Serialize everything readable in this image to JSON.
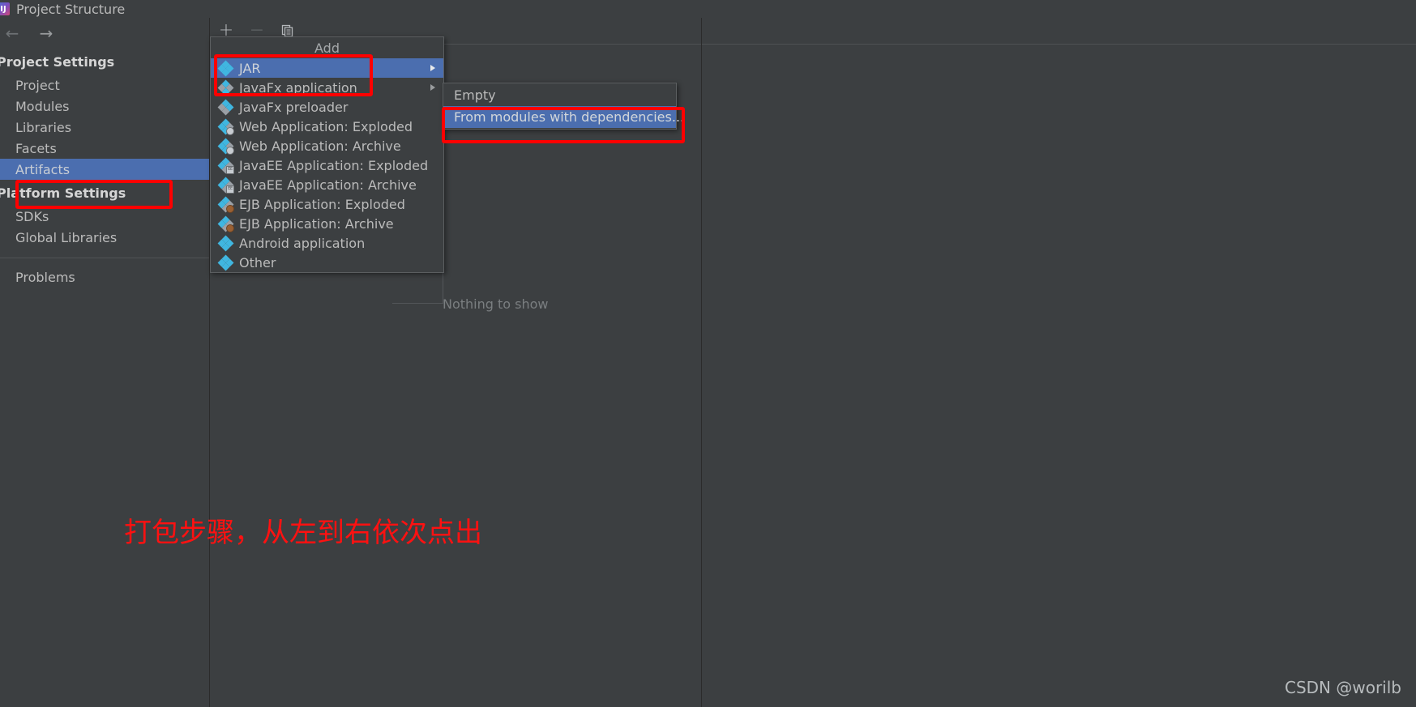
{
  "window": {
    "title": "Project Structure",
    "app_icon": "intellij-idea-icon"
  },
  "nav": {
    "back_label": "←",
    "forward_label": "→"
  },
  "sidebar": {
    "project_settings_title": "Project Settings",
    "project_items": [
      {
        "label": "Project"
      },
      {
        "label": "Modules"
      },
      {
        "label": "Libraries"
      },
      {
        "label": "Facets"
      },
      {
        "label": "Artifacts"
      }
    ],
    "platform_settings_title": "Platform Settings",
    "platform_items": [
      {
        "label": "SDKs"
      },
      {
        "label": "Global Libraries"
      }
    ],
    "other_items": [
      {
        "label": "Problems"
      }
    ],
    "selected": "Artifacts"
  },
  "toolbar": {
    "add_label": "+",
    "remove_label": "−",
    "copy_label": "copy-icon"
  },
  "popup_menu": {
    "title": "Add",
    "items": [
      {
        "label": "JAR",
        "icon": "diamond-blue-icon",
        "has_submenu": true,
        "selected": true
      },
      {
        "label": "JavaFx application",
        "icon": "diamond-blue-icon",
        "has_submenu": true,
        "selected": false
      },
      {
        "label": "JavaFx preloader",
        "icon": "diamond-blue-icon",
        "has_submenu": false,
        "selected": false
      },
      {
        "label": "Web Application: Exploded",
        "icon": "diamond-globe-icon",
        "has_submenu": false,
        "selected": false
      },
      {
        "label": "Web Application: Archive",
        "icon": "diamond-globe-icon",
        "has_submenu": false,
        "selected": false
      },
      {
        "label": "JavaEE Application: Exploded",
        "icon": "diamond-ee-icon",
        "has_submenu": false,
        "selected": false
      },
      {
        "label": "JavaEE Application: Archive",
        "icon": "diamond-ee-icon",
        "has_submenu": false,
        "selected": false
      },
      {
        "label": "EJB Application: Exploded",
        "icon": "diamond-bean-icon",
        "has_submenu": false,
        "selected": false
      },
      {
        "label": "EJB Application: Archive",
        "icon": "diamond-bean-icon",
        "has_submenu": false,
        "selected": false
      },
      {
        "label": "Android application",
        "icon": "diamond-blue-icon",
        "has_submenu": false,
        "selected": false
      },
      {
        "label": "Other",
        "icon": "diamond-blue-icon",
        "has_submenu": false,
        "selected": false
      }
    ]
  },
  "submenu": {
    "items": [
      {
        "label": "Empty",
        "selected": false
      },
      {
        "label": "From modules with dependencies...",
        "selected": true
      }
    ]
  },
  "right_panel": {
    "empty_message": "Nothing to show"
  },
  "annotations": {
    "note_text": "打包步骤，从左到右依次点出",
    "note_color": "#ff0000",
    "highlight_color": "#ff0000",
    "boxes": [
      {
        "target": "Artifacts"
      },
      {
        "target": "Add / JAR"
      },
      {
        "target": "From modules with dependencies..."
      }
    ]
  },
  "watermark": {
    "text": "CSDN @worilb"
  },
  "colors": {
    "background": "#3c3f41",
    "selection": "#4b6eaf",
    "text": "#bbbbbb",
    "muted_text": "#7a7e80",
    "accent_icon": "#40b6e0",
    "annotation": "#ff0000"
  }
}
